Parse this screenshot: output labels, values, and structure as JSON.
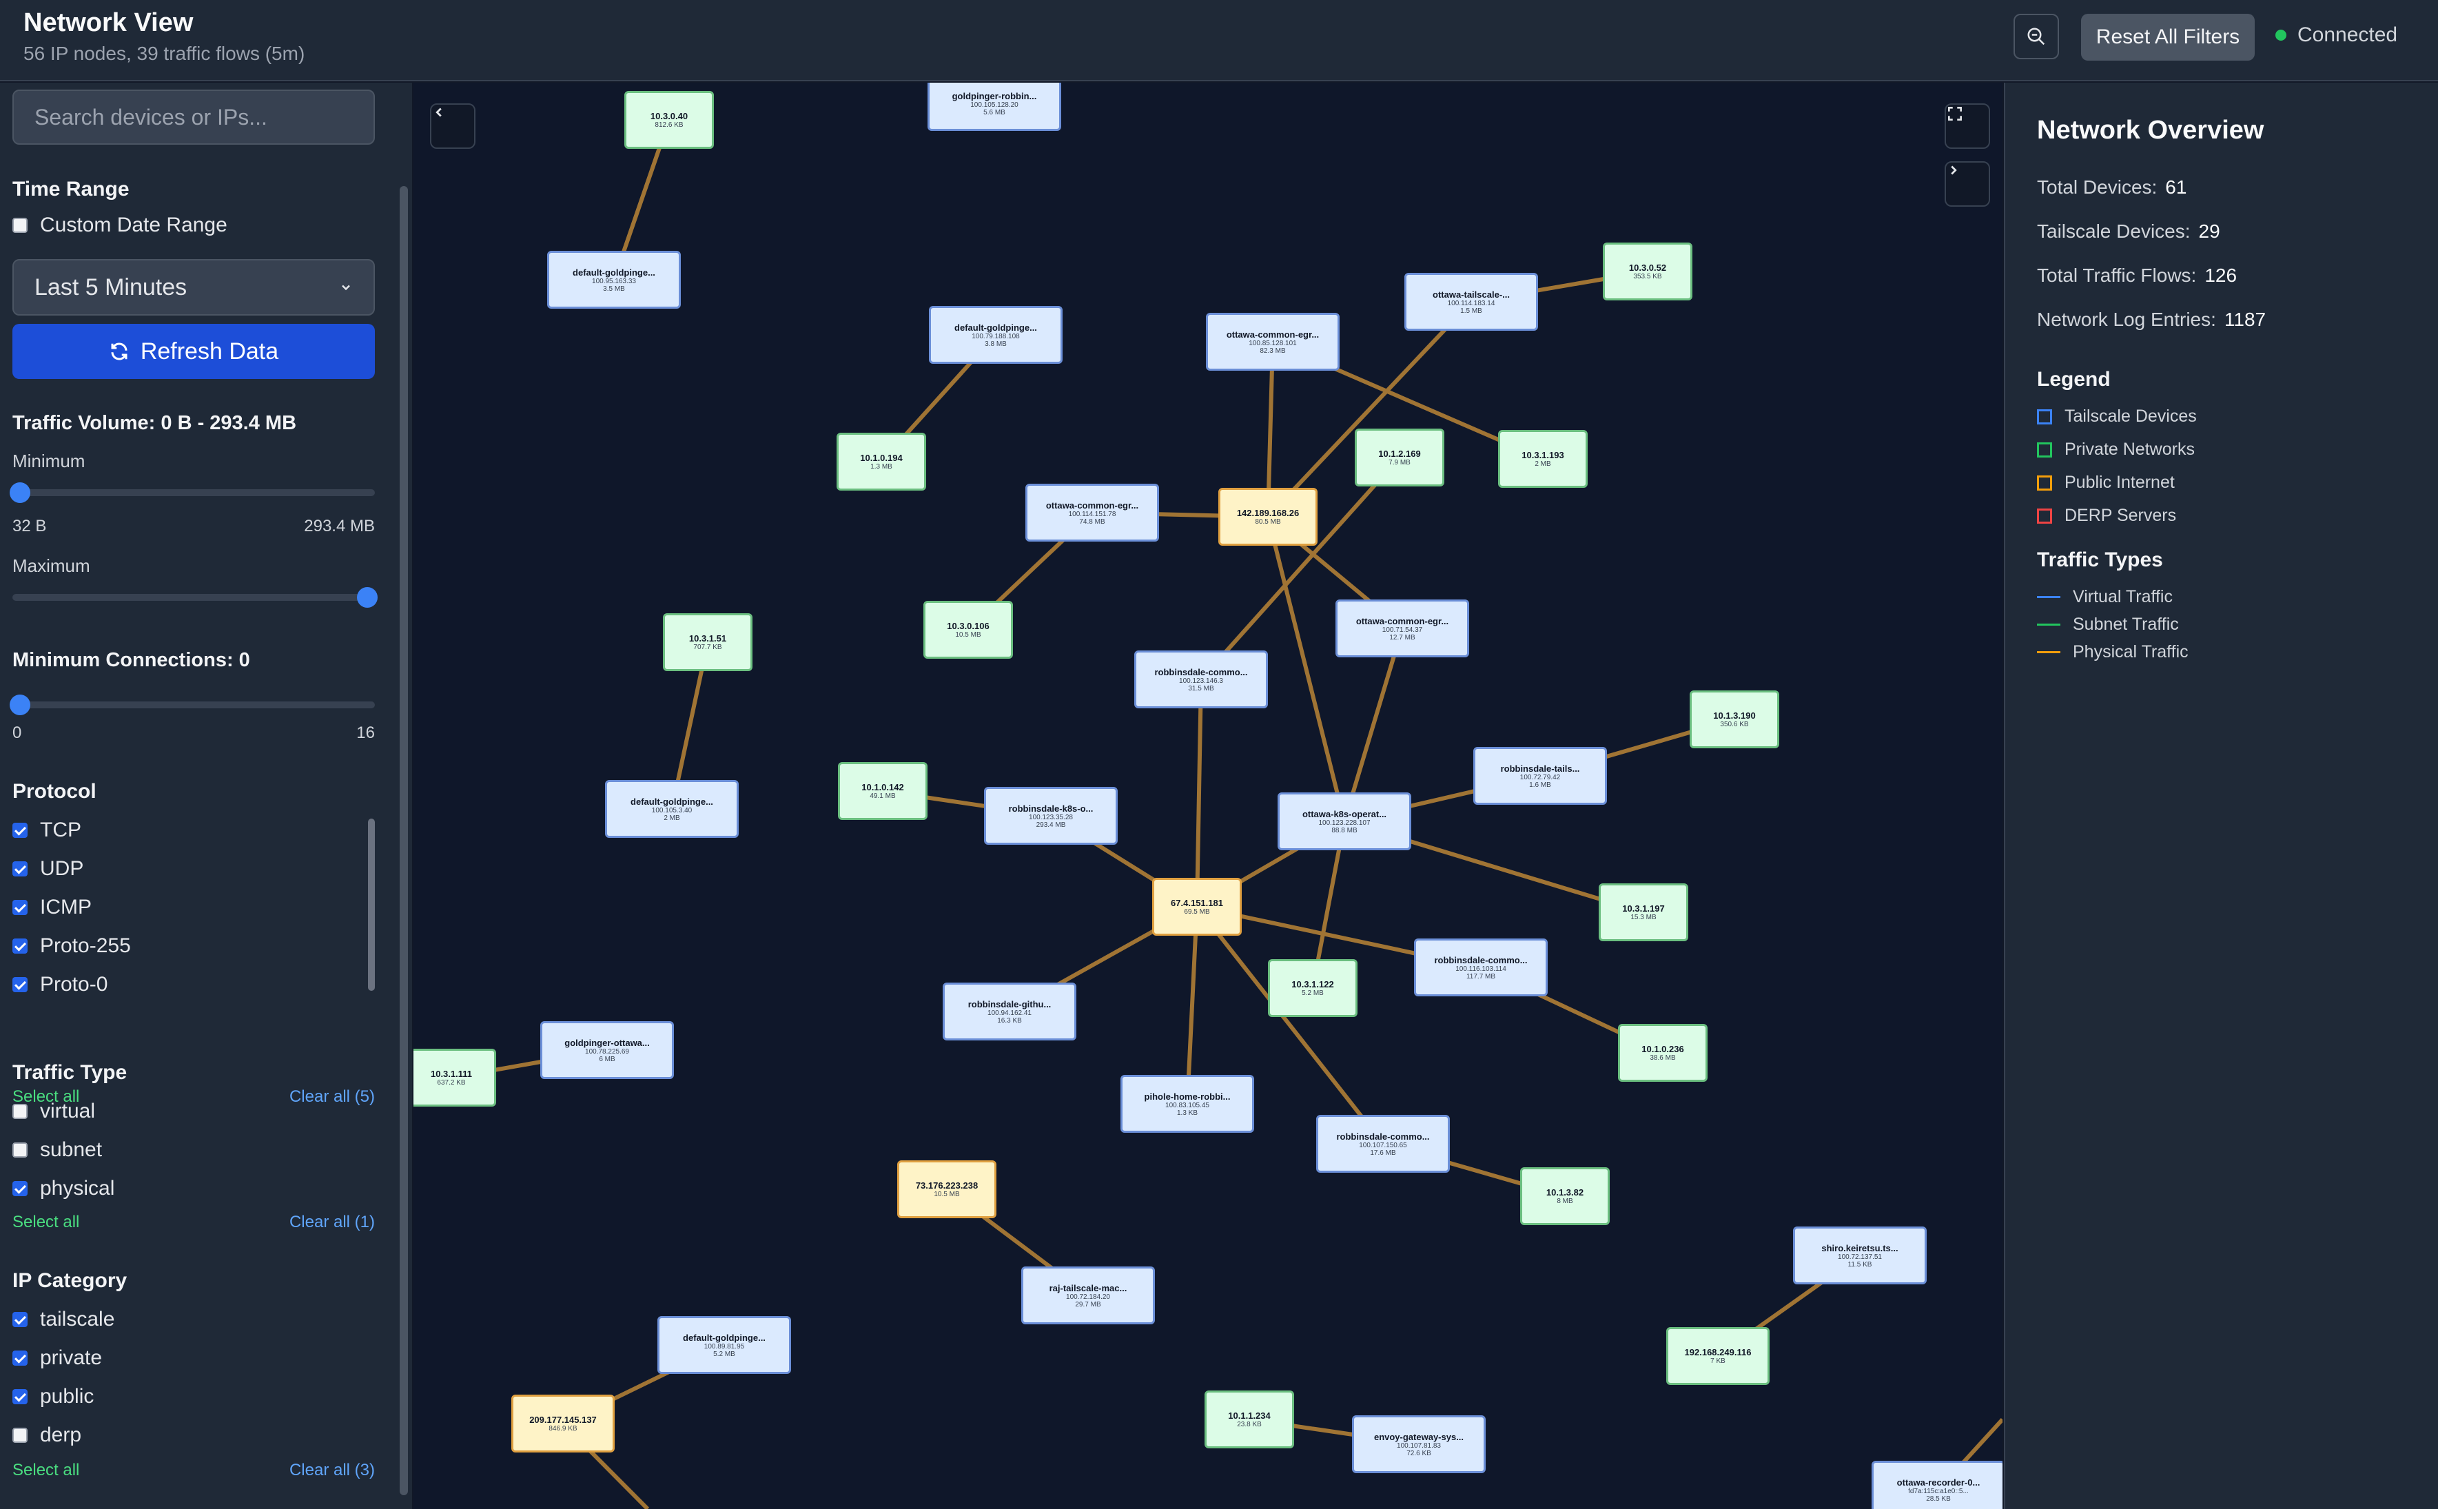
{
  "header": {
    "title": "Network View",
    "subtitle": "56 IP nodes, 39 traffic flows (5m)",
    "reset_label": "Reset All Filters",
    "status": "Connected",
    "zoom_icon": "zoom-out-icon"
  },
  "sidebar": {
    "search_placeholder": "Search devices or IPs...",
    "time_range_title": "Time Range",
    "custom_date_label": "Custom Date Range",
    "time_range_value": "Last 5 Minutes",
    "refresh_label": "Refresh Data",
    "traffic_volume_title": "Traffic Volume: 0 B - 293.4 MB",
    "minimum_label": "Minimum",
    "min_value": "32 B",
    "max_value": "293.4 MB",
    "maximum_label": "Maximum",
    "min_connections_title": "Minimum Connections: 0",
    "conn_min": "0",
    "conn_max": "16",
    "protocol_title": "Protocol",
    "protocols": [
      {
        "label": "TCP",
        "checked": true
      },
      {
        "label": "UDP",
        "checked": true
      },
      {
        "label": "ICMP",
        "checked": true
      },
      {
        "label": "Proto-255",
        "checked": true
      },
      {
        "label": "Proto-0",
        "checked": true
      }
    ],
    "protocol_select_all": "Select all",
    "protocol_clear_all": "Clear all (5)",
    "traffic_type_title": "Traffic Type",
    "traffic_types": [
      {
        "label": "virtual",
        "checked": false
      },
      {
        "label": "subnet",
        "checked": false
      },
      {
        "label": "physical",
        "checked": true
      }
    ],
    "traffic_select_all": "Select all",
    "traffic_clear_all": "Clear all (1)",
    "ip_category_title": "IP Category",
    "ip_categories": [
      {
        "label": "tailscale",
        "checked": true
      },
      {
        "label": "private",
        "checked": true
      },
      {
        "label": "public",
        "checked": true
      },
      {
        "label": "derp",
        "checked": false
      }
    ],
    "ip_select_all": "Select all",
    "ip_clear_all": "Clear all (3)"
  },
  "overview": {
    "title": "Network Overview",
    "stats": [
      {
        "label": "Total Devices:",
        "value": "61"
      },
      {
        "label": "Tailscale Devices:",
        "value": "29"
      },
      {
        "label": "Total Traffic Flows:",
        "value": "126"
      },
      {
        "label": "Network Log Entries:",
        "value": "1187"
      }
    ],
    "legend_title": "Legend",
    "legend": [
      {
        "label": "Tailscale Devices",
        "color": "#3b82f6"
      },
      {
        "label": "Private Networks",
        "color": "#22c55e"
      },
      {
        "label": "Public Internet",
        "color": "#f59e0b"
      },
      {
        "label": "DERP Servers",
        "color": "#ef4444"
      }
    ],
    "traffic_types_title": "Traffic Types",
    "traffic_types": [
      {
        "label": "Virtual Traffic",
        "color": "#3b82f6"
      },
      {
        "label": "Subnet Traffic",
        "color": "#22c55e"
      },
      {
        "label": "Physical Traffic",
        "color": "#f59e0b"
      }
    ]
  },
  "graph": {
    "nodes": [
      {
        "id": "n1",
        "type": "priv",
        "name": "10.3.0.40",
        "ip": "",
        "size": "812.6 KB"
      },
      {
        "id": "n2",
        "type": "tail",
        "name": "goldpinger-robbin...",
        "ip": "100.105.128.20",
        "size": "5.6 MB"
      },
      {
        "id": "n3",
        "type": "tail",
        "name": "default-goldpinge...",
        "ip": "100.95.163.33",
        "size": "3.5 MB"
      },
      {
        "id": "n4",
        "type": "tail",
        "name": "default-goldpinge...",
        "ip": "100.79.188.108",
        "size": "3.8 MB"
      },
      {
        "id": "n5",
        "type": "tail",
        "name": "ottawa-common-egr...",
        "ip": "100.85.128.101",
        "size": "82.3 MB"
      },
      {
        "id": "n6",
        "type": "tail",
        "name": "ottawa-tailscale-...",
        "ip": "100.114.183.14",
        "size": "1.5 MB"
      },
      {
        "id": "n7",
        "type": "priv",
        "name": "10.3.0.52",
        "ip": "",
        "size": "353.5 KB"
      },
      {
        "id": "n8",
        "type": "priv",
        "name": "10.1.0.194",
        "ip": "",
        "size": "1.3 MB"
      },
      {
        "id": "n9",
        "type": "tail",
        "name": "ottawa-common-egr...",
        "ip": "100.114.151.78",
        "size": "74.8 MB"
      },
      {
        "id": "n10",
        "type": "pub",
        "name": "142.189.168.26",
        "ip": "",
        "size": "80.5 MB"
      },
      {
        "id": "n11",
        "type": "priv",
        "name": "10.1.2.169",
        "ip": "",
        "size": "7.9 MB"
      },
      {
        "id": "n12",
        "type": "priv",
        "name": "10.3.1.193",
        "ip": "",
        "size": "2 MB"
      },
      {
        "id": "n13",
        "type": "priv",
        "name": "10.3.0.106",
        "ip": "",
        "size": "10.5 MB"
      },
      {
        "id": "n14",
        "type": "tail",
        "name": "ottawa-common-egr...",
        "ip": "100.71.54.37",
        "size": "12.7 MB"
      },
      {
        "id": "n15",
        "type": "priv",
        "name": "10.3.1.51",
        "ip": "",
        "size": "707.7 KB"
      },
      {
        "id": "n16",
        "type": "tail",
        "name": "robbinsdale-commo...",
        "ip": "100.123.146.3",
        "size": "31.5 MB"
      },
      {
        "id": "n17",
        "type": "priv",
        "name": "10.1.3.190",
        "ip": "",
        "size": "350.6 KB"
      },
      {
        "id": "n18",
        "type": "tail",
        "name": "robbinsdale-tails...",
        "ip": "100.72.79.42",
        "size": "1.6 MB"
      },
      {
        "id": "n19",
        "type": "tail",
        "name": "default-goldpinge...",
        "ip": "100.105.3.40",
        "size": "2 MB"
      },
      {
        "id": "n20",
        "type": "priv",
        "name": "10.1.0.142",
        "ip": "",
        "size": "49.1 MB"
      },
      {
        "id": "n21",
        "type": "tail",
        "name": "robbinsdale-k8s-o...",
        "ip": "100.123.35.28",
        "size": "293.4 MB"
      },
      {
        "id": "n22",
        "type": "tail",
        "name": "ottawa-k8s-operat...",
        "ip": "100.123.228.107",
        "size": "88.8 MB"
      },
      {
        "id": "n23",
        "type": "pub",
        "name": "67.4.151.181",
        "ip": "",
        "size": "69.5 MB"
      },
      {
        "id": "n24",
        "type": "priv",
        "name": "10.3.1.197",
        "ip": "",
        "size": "15.3 MB"
      },
      {
        "id": "n25",
        "type": "tail",
        "name": "robbinsdale-commo...",
        "ip": "100.116.103.114",
        "size": "117.7 MB"
      },
      {
        "id": "n26",
        "type": "priv",
        "name": "10.3.1.122",
        "ip": "",
        "size": "5.2 MB"
      },
      {
        "id": "n27",
        "type": "tail",
        "name": "robbinsdale-githu...",
        "ip": "100.94.162.41",
        "size": "16.3 KB"
      },
      {
        "id": "n28",
        "type": "priv",
        "name": "10.1.0.236",
        "ip": "",
        "size": "38.6 MB"
      },
      {
        "id": "n29",
        "type": "priv",
        "name": "10.3.1.111",
        "ip": "",
        "size": "637.2 KB"
      },
      {
        "id": "n30",
        "type": "tail",
        "name": "goldpinger-ottawa...",
        "ip": "100.78.225.69",
        "size": "6 MB"
      },
      {
        "id": "n31",
        "type": "tail",
        "name": "pihole-home-robbi...",
        "ip": "100.83.105.45",
        "size": "1.3 KB"
      },
      {
        "id": "n32",
        "type": "tail",
        "name": "robbinsdale-commo...",
        "ip": "100.107.150.65",
        "size": "17.6 MB"
      },
      {
        "id": "n33",
        "type": "priv",
        "name": "10.1.3.82",
        "ip": "",
        "size": "8 MB"
      },
      {
        "id": "n34",
        "type": "pub",
        "name": "73.176.223.238",
        "ip": "",
        "size": "10.5 MB"
      },
      {
        "id": "n35",
        "type": "tail",
        "name": "raj-tailscale-mac...",
        "ip": "100.72.184.20",
        "size": "29.7 MB"
      },
      {
        "id": "n36",
        "type": "tail",
        "name": "shiro.keiretsu.ts...",
        "ip": "100.72.137.51",
        "size": "11.5 KB"
      },
      {
        "id": "n37",
        "type": "tail",
        "name": "default-goldpinge...",
        "ip": "100.89.81.95",
        "size": "5.2 MB"
      },
      {
        "id": "n38",
        "type": "priv",
        "name": "192.168.249.116",
        "ip": "",
        "size": "7 KB"
      },
      {
        "id": "n39",
        "type": "pub",
        "name": "209.177.145.137",
        "ip": "",
        "size": "846.9 KB"
      },
      {
        "id": "n40",
        "type": "priv",
        "name": "10.1.1.234",
        "ip": "",
        "size": "23.8 KB"
      },
      {
        "id": "n41",
        "type": "tail",
        "name": "envoy-gateway-sys...",
        "ip": "100.107.81.83",
        "size": "72.6 KB"
      },
      {
        "id": "n42",
        "type": "tail",
        "name": "ottawa-recorder-0...",
        "ip": "fd7a:115c:a1e0::5...",
        "size": "28.5 KB"
      }
    ]
  }
}
